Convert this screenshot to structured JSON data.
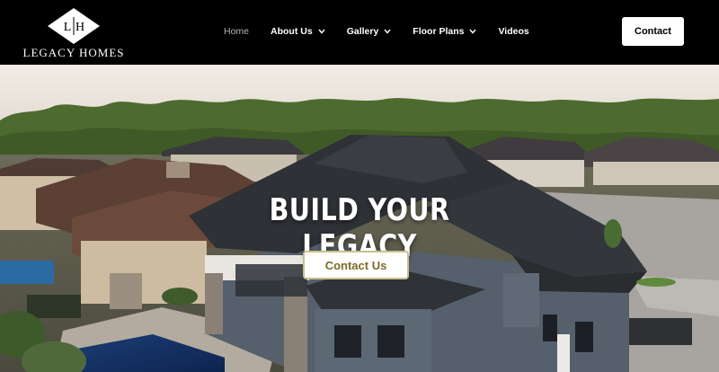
{
  "brand": {
    "monogram_left": "L",
    "monogram_right": "H",
    "name": "LEGACY HOMES"
  },
  "nav": {
    "items": [
      {
        "label": "Home",
        "active": true,
        "has_dropdown": false
      },
      {
        "label": "About Us",
        "active": false,
        "has_dropdown": true
      },
      {
        "label": "Gallery",
        "active": false,
        "has_dropdown": true
      },
      {
        "label": "Floor Plans",
        "active": false,
        "has_dropdown": true
      },
      {
        "label": "Videos",
        "active": false,
        "has_dropdown": false
      }
    ],
    "contact_label": "Contact"
  },
  "hero": {
    "headline": "BUILD YOUR LEGACY",
    "cta_label": "Contact Us"
  },
  "colors": {
    "header_bg": "#000000",
    "cta_text": "#7a6b28",
    "cta_border": "#c9bf8b"
  },
  "icons": {
    "dropdown": "chevron-down-icon",
    "logo": "diamond-logo-icon"
  }
}
